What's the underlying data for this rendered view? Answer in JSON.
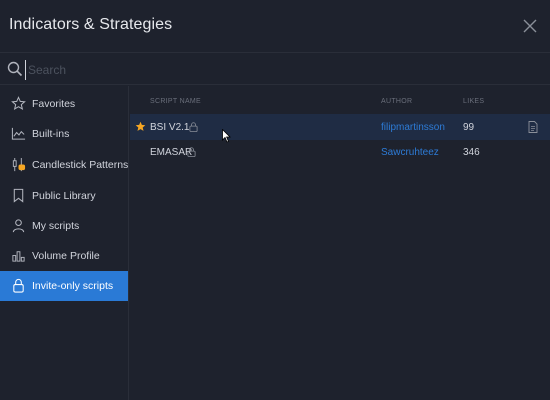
{
  "dialog": {
    "title": "Indicators & Strategies",
    "close_icon": "close-icon"
  },
  "search": {
    "placeholder": "Search",
    "value": "",
    "icon": "search-icon"
  },
  "sidebar": {
    "items": [
      {
        "label": "Favorites",
        "icon": "star-icon",
        "active": false
      },
      {
        "label": "Built-ins",
        "icon": "chart-icon",
        "active": false
      },
      {
        "label": "Candlestick Patterns",
        "icon": "candlestick-icon",
        "active": false
      },
      {
        "label": "Public Library",
        "icon": "bookmark-icon",
        "active": false
      },
      {
        "label": "My scripts",
        "icon": "user-icon",
        "active": false
      },
      {
        "label": "Volume Profile",
        "icon": "volume-profile-icon",
        "active": false
      },
      {
        "label": "Invite-only scripts",
        "icon": "lock-icon",
        "active": true
      }
    ]
  },
  "table": {
    "columns": {
      "script_name": "SCRIPT NAME",
      "author": "AUTHOR",
      "likes": "LIKES"
    },
    "rows": [
      {
        "name": "BSI V2.1",
        "author": "filipmartinsson",
        "likes": "99",
        "favorite": true,
        "locked": true
      },
      {
        "name": "EMASAR",
        "author": "Sawcruhteez",
        "likes": "346",
        "favorite": false,
        "locked": true
      }
    ]
  },
  "colors": {
    "background": "#1e222d",
    "accent": "#2a7ad6",
    "link": "#2d7bd6",
    "star": "#f5a623",
    "highlight_row": "#1f2c44"
  }
}
